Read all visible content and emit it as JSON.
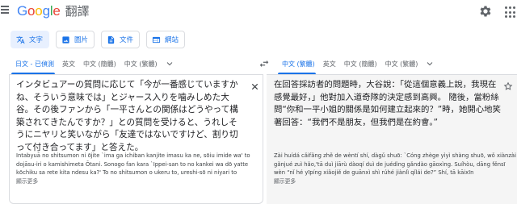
{
  "header": {
    "logo_g": "G",
    "logo_o1": "o",
    "logo_o2": "o",
    "logo_g2": "g",
    "logo_l": "l",
    "logo_e": "e",
    "product": "翻譯"
  },
  "modes": [
    {
      "label": "文字",
      "icon": "text-translate-icon",
      "active": true
    },
    {
      "label": "圖片",
      "icon": "image-icon",
      "active": false
    },
    {
      "label": "文件",
      "icon": "document-icon",
      "active": false
    },
    {
      "label": "網站",
      "icon": "website-icon",
      "active": false
    }
  ],
  "source_langs": [
    "日文 - 已偵測",
    "英文",
    "中文 (簡體)",
    "中文 (繁體)"
  ],
  "target_langs": [
    "中文 (繁體)",
    "英文",
    "中文 (簡體)",
    "中文 (繁體)"
  ],
  "source": {
    "text": "インタビュアーの質問に応じて「今が一番感じていますかね、そういう意味では」とジャース入りを噛みしめた大谷。その後ファンから「一平さんとの関係はどうやって構築されてきたんですか？」との質問を受けると、うれしそうにニヤリと笑いながら「友達ではないですけど、割り切って付き合ってます」と答えた。",
    "romanization": "Intabyuā no shitsumon ni ōjite `ima ga ichiban kanjite imasu ka ne, sōiu imide wa' to dojāsu-iri o kamishimeta Ōtani. Sonogo fan kara `Ippei-san to no kankei wa dō yatte kōchiku sa rete kita ndesu ka?' To no shitsumon o ukeru to, ureshi-sō ni niyari to",
    "show_more": "顯示更多"
  },
  "target": {
    "text": "在回答採訪者的問題時，大谷說：「從這個意義上說，我現在感覺最好，」他對加入道奇隊的決定感到高興。 隨後，當粉絲問“你和一平小姐的關係是如何建立起來的？”時，她開心地笑著回答：“我們不是朋友，但我們是在約會。”",
    "romanization": "Zài huídá cǎifǎng zhě de wèntí shí, dàgǔ shuō: `Cóng zhège yìyì shàng shuō, wǒ xiànzài gǎnjué zuì hǎo,'tā duì jiārù dàoqí duì de juédìng gǎndào gāoxìng. Suíhòu, dāng fěnsī wèn “nǐ hé yīpíng xiǎojiě de guānxì shì rúhé jiànlì qǐlái de?” Shí, tā kāixīn",
    "show_more": "顯示更多"
  },
  "colors": {
    "accent": "#1a73e8",
    "chip_bg": "#e8f0fe",
    "target_bg": "#f5f5f5"
  }
}
